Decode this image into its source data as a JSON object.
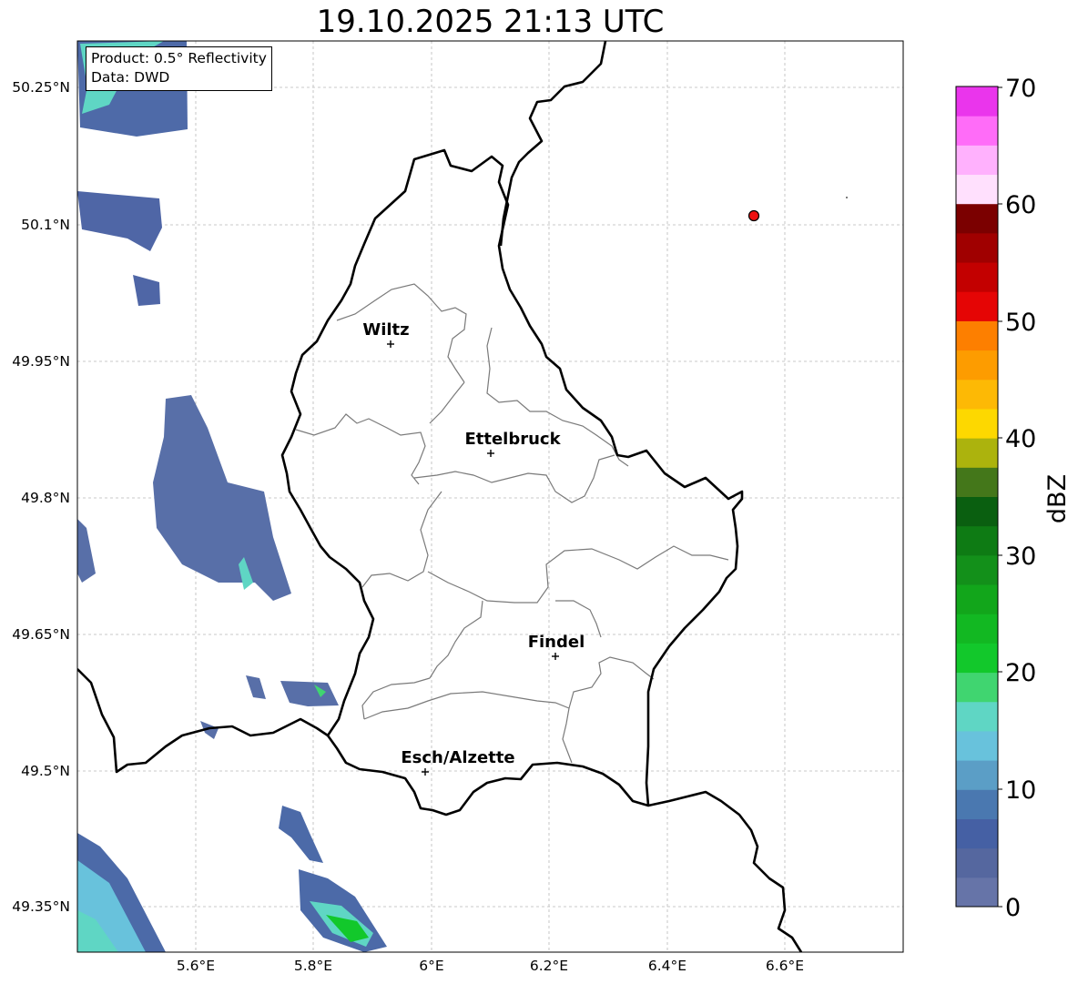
{
  "title": "19.10.2025 21:13 UTC",
  "info_box": {
    "product": "Product: 0.5° Reflectivity",
    "source": "Data: DWD"
  },
  "lat_labels": [
    "50.25°N",
    "50.1°N",
    "49.95°N",
    "49.8°N",
    "49.65°N",
    "49.5°N",
    "49.35°N"
  ],
  "lon_labels": [
    "5.6°E",
    "5.8°E",
    "6°E",
    "6.2°E",
    "6.4°E",
    "6.6°E"
  ],
  "cities": [
    {
      "name": "Wiltz"
    },
    {
      "name": "Ettelbruck"
    },
    {
      "name": "Findel"
    },
    {
      "name": "Esch/Alzette"
    }
  ],
  "colorbar": {
    "label": "dBZ",
    "ticks": [
      "0",
      "10",
      "20",
      "30",
      "40",
      "50",
      "60",
      "70"
    ],
    "colors": [
      "#6674a8",
      "#55679f",
      "#4560a4",
      "#4a78b0",
      "#5b9ec6",
      "#68c2dc",
      "#5fd6c4",
      "#40d570",
      "#12c82b",
      "#12b822",
      "#12a61b",
      "#13901a",
      "#0e7b14",
      "#0a5f10",
      "#44771a",
      "#acb30d",
      "#fdd800",
      "#fdb905",
      "#fd9c00",
      "#fd7f00",
      "#e50505",
      "#c30000",
      "#a00000",
      "#7b0000",
      "#ffe0fd",
      "#ffb1fd",
      "#ff6cf8",
      "#ea35ec"
    ]
  },
  "marker": {
    "color": "#ee1111"
  }
}
